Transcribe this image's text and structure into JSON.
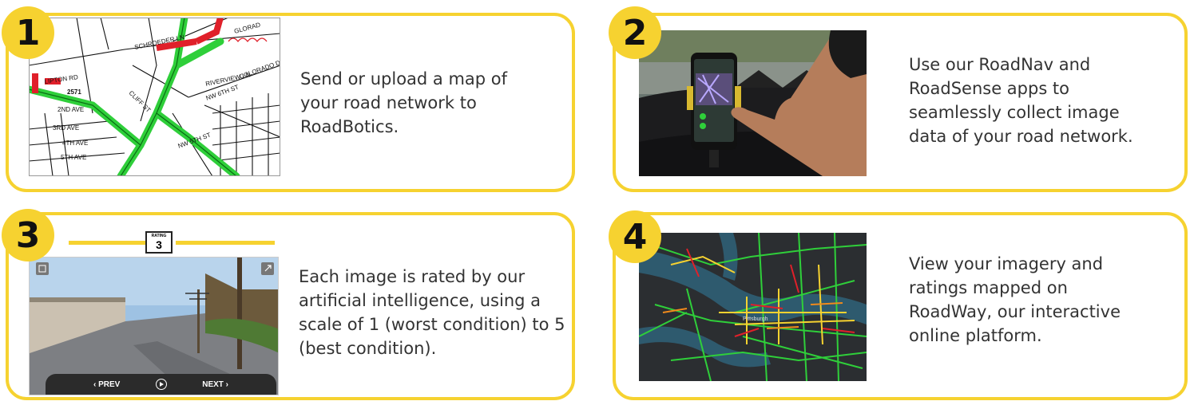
{
  "steps": [
    {
      "number": "1",
      "text": "Send or upload a map of your road network to RoadBotics."
    },
    {
      "number": "2",
      "text": "Use our RoadNav and RoadSense apps to seamlessly collect image data of your road network."
    },
    {
      "number": "3",
      "text": "Each image is rated by our artificial intelligence, using a scale of 1 (worst condition) to 5 (best condition)."
    },
    {
      "number": "4",
      "text": "View your imagery and ratings mapped on RoadWay, our interactive online platform."
    }
  ],
  "map_labels": {
    "schroeder": "SCHROEDER LN",
    "glorad": "GLORAD",
    "lipton": "LIPTON RD",
    "route": "2571",
    "second_ave": "2ND AVE",
    "third_ave": "3RD AVE",
    "fourth_ave": "4TH AVE",
    "fifth_ave": "5TH AVE",
    "nw_sixth": "NW 6TH ST",
    "nw_fifth": "NW 5TH ST",
    "riverview": "RIVERVIEW LN",
    "colorado": "COLORADO DR",
    "cliff": "CLIFF ST"
  },
  "rating_viewer": {
    "rating_label": "RATING",
    "rating_value": "3",
    "prev_label": "‹ PREV",
    "next_label": "NEXT ›"
  },
  "city_map": {
    "city_label": "Pittsburgh"
  },
  "colors": {
    "accent": "#f6d230",
    "good_road": "#2fcf3a",
    "poor_road": "#e0202a"
  },
  "icons": {
    "play": "play-circle-icon",
    "image": "image-icon",
    "expand": "expand-icon"
  }
}
